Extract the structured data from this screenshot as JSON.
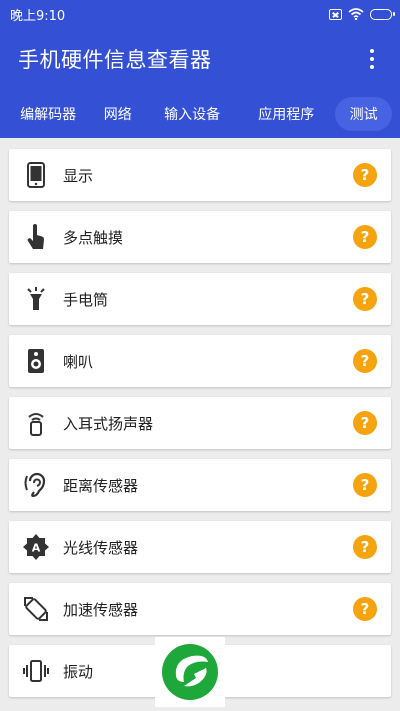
{
  "status_bar": {
    "time": "晚上9:10"
  },
  "app_bar": {
    "title": "手机硬件信息查看器"
  },
  "tabs": [
    {
      "label": "编解码器"
    },
    {
      "label": "网络"
    },
    {
      "label": "输入设备"
    },
    {
      "label": "应用程序"
    },
    {
      "label": "测试",
      "selected": true
    }
  ],
  "list": [
    {
      "label": "显示",
      "icon": "phone-icon",
      "help": "?"
    },
    {
      "label": "多点触摸",
      "icon": "touch-hand-icon",
      "help": "?"
    },
    {
      "label": "手电筒",
      "icon": "flashlight-icon",
      "help": "?"
    },
    {
      "label": "喇叭",
      "icon": "speaker-icon",
      "help": "?"
    },
    {
      "label": "入耳式扬声器",
      "icon": "earpiece-icon",
      "help": "?"
    },
    {
      "label": "距离传感器",
      "icon": "ear-proximity-icon",
      "help": "?"
    },
    {
      "label": "光线传感器",
      "icon": "light-sensor-icon",
      "help": "?"
    },
    {
      "label": "加速传感器",
      "icon": "accelerometer-icon",
      "help": "?"
    },
    {
      "label": "振动",
      "icon": "vibration-icon"
    }
  ],
  "colors": {
    "primary": "#3451d6",
    "accent": "#f5a40f",
    "background": "#ececec"
  },
  "watermark": "green-leaf-logo"
}
